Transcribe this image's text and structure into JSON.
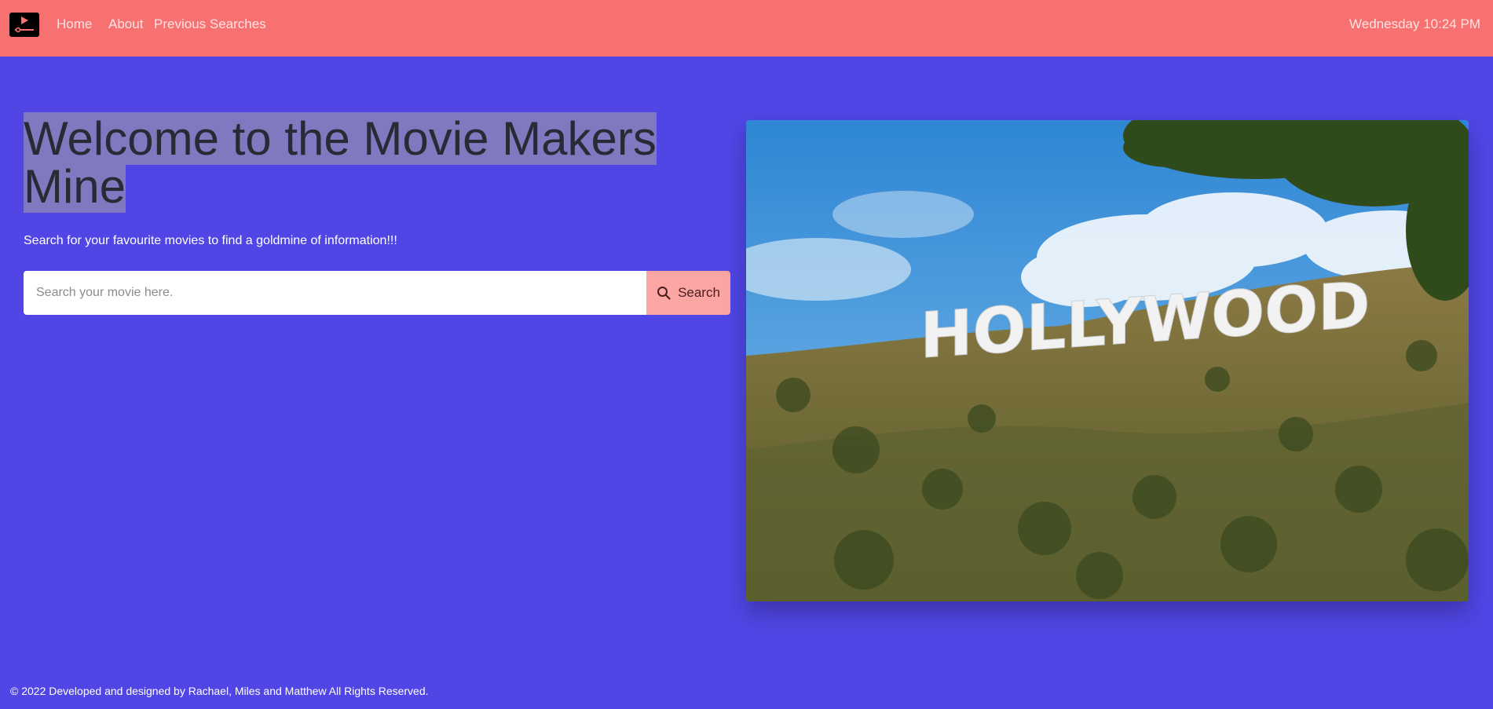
{
  "navbar": {
    "logo_icon": "video-player-icon",
    "links": [
      {
        "label": "Home"
      },
      {
        "label": "About"
      },
      {
        "label": "Previous Searches"
      }
    ],
    "datetime": "Wednesday 10:24 PM",
    "colors": {
      "background": "#f87171",
      "link": "#fde2e2"
    }
  },
  "hero": {
    "title": "Welcome to the Movie Makers Mine",
    "subtitle": "Search for your favourite movies to find a goldmine of information!!!"
  },
  "search": {
    "placeholder": "Search your movie here.",
    "value": "",
    "button_label": "Search",
    "button_icon": "search-icon"
  },
  "image": {
    "sign_text": "HOLLYWOOD"
  },
  "footer": {
    "text": "© 2022 Developed and designed by Rachael, Miles and Matthew All Rights Reserved."
  },
  "colors": {
    "page_background": "#4f46e5",
    "search_button": "#fca5a5",
    "title_highlight": "#8079c0"
  }
}
